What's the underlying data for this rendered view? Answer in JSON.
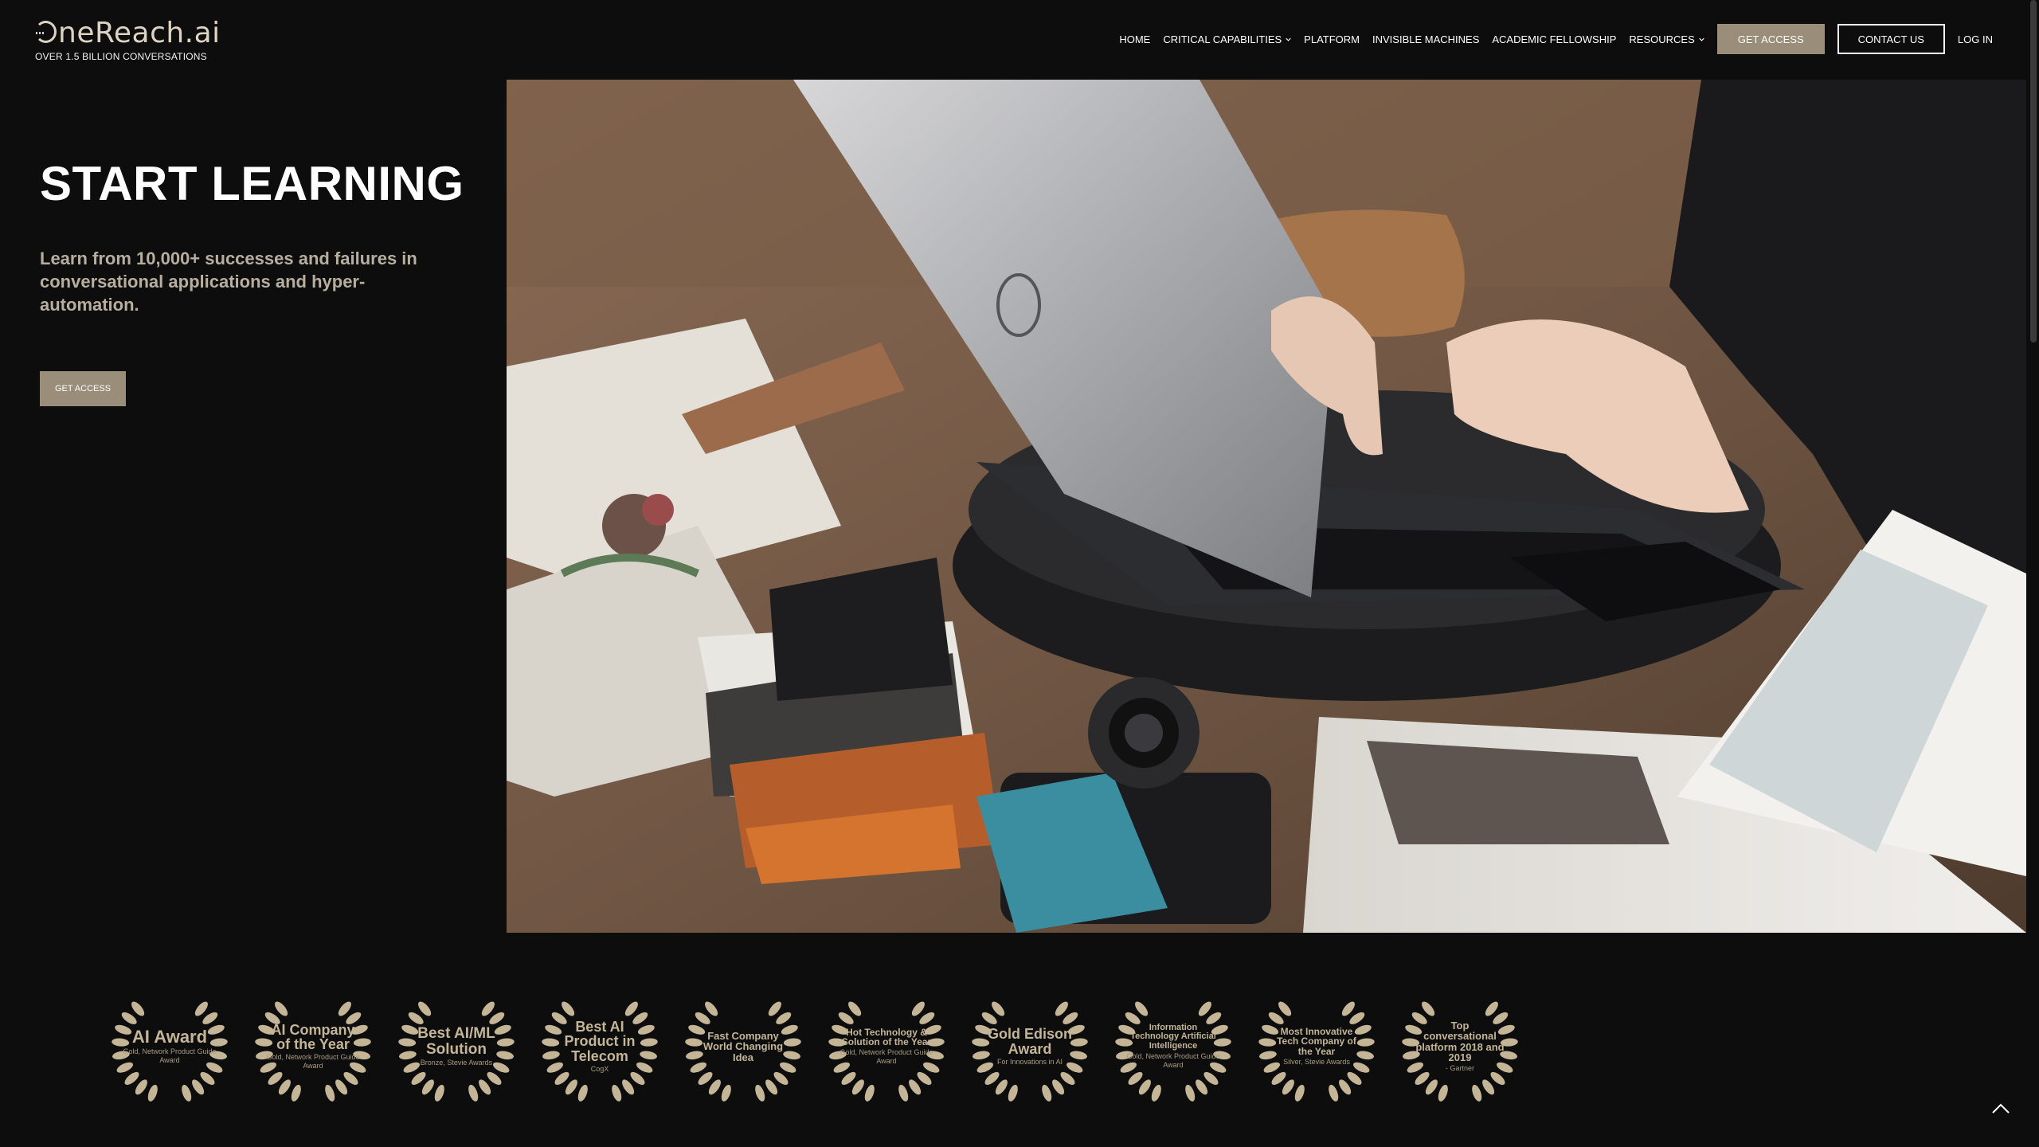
{
  "brand": {
    "logo_text": "neReach.ai",
    "tagline": "OVER 1.5 BILLION CONVERSATIONS",
    "accent_color": "#9a8d79",
    "gold_color": "#c4b596"
  },
  "nav": {
    "items": [
      {
        "label": "HOME",
        "dropdown": false
      },
      {
        "label": "CRITICAL CAPABILITIES",
        "dropdown": true
      },
      {
        "label": "PLATFORM",
        "dropdown": false
      },
      {
        "label": "INVISIBLE MACHINES",
        "dropdown": false
      },
      {
        "label": "ACADEMIC FELLOWSHIP",
        "dropdown": false
      },
      {
        "label": "RESOURCES",
        "dropdown": true
      }
    ],
    "get_access": "GET ACCESS",
    "contact_us": "CONTACT US",
    "log_in": "LOG IN"
  },
  "hero": {
    "title": "START LEARNING",
    "subtitle": "Learn from 10,000+ successes and failures in conversational applications and hyper-automation.",
    "cta": "GET ACCESS",
    "image_icon": "laptop-photo"
  },
  "awards": [
    {
      "main": "AI Award",
      "small": "Gold, Network Product Guide Award",
      "main_size": 22
    },
    {
      "main": "AI Company of the Year",
      "small": "Gold, Network Product Guide Award",
      "main_size": 18
    },
    {
      "main": "Best AI/ML Solution",
      "small": "Bronze, Stevie Awards",
      "main_size": 19
    },
    {
      "main": "Best AI Product in Telecom",
      "small": "CogX",
      "main_size": 18
    },
    {
      "main": "Fast Company World Changing Idea",
      "small": "",
      "main_size": 13
    },
    {
      "main": "Hot Technology & Solution of the Year",
      "small": "Gold, Network Product Guide Award",
      "main_size": 12
    },
    {
      "main": "Gold Edison Award",
      "small": "For Innovations in AI",
      "main_size": 18
    },
    {
      "main": "Information Technology Artificial Intelligence",
      "small": "Gold, Network Product Guide Award",
      "main_size": 11
    },
    {
      "main": "Most Innovative Tech Company of the Year",
      "small": "Silver, Stevie Awards",
      "main_size": 12
    },
    {
      "main": "Top conversational platform 2018 and 2019",
      "small": "- Gartner",
      "main_size": 13
    }
  ],
  "icons": {
    "back_to_top": "chevron-up-icon",
    "dropdown": "chevron-down-icon"
  }
}
